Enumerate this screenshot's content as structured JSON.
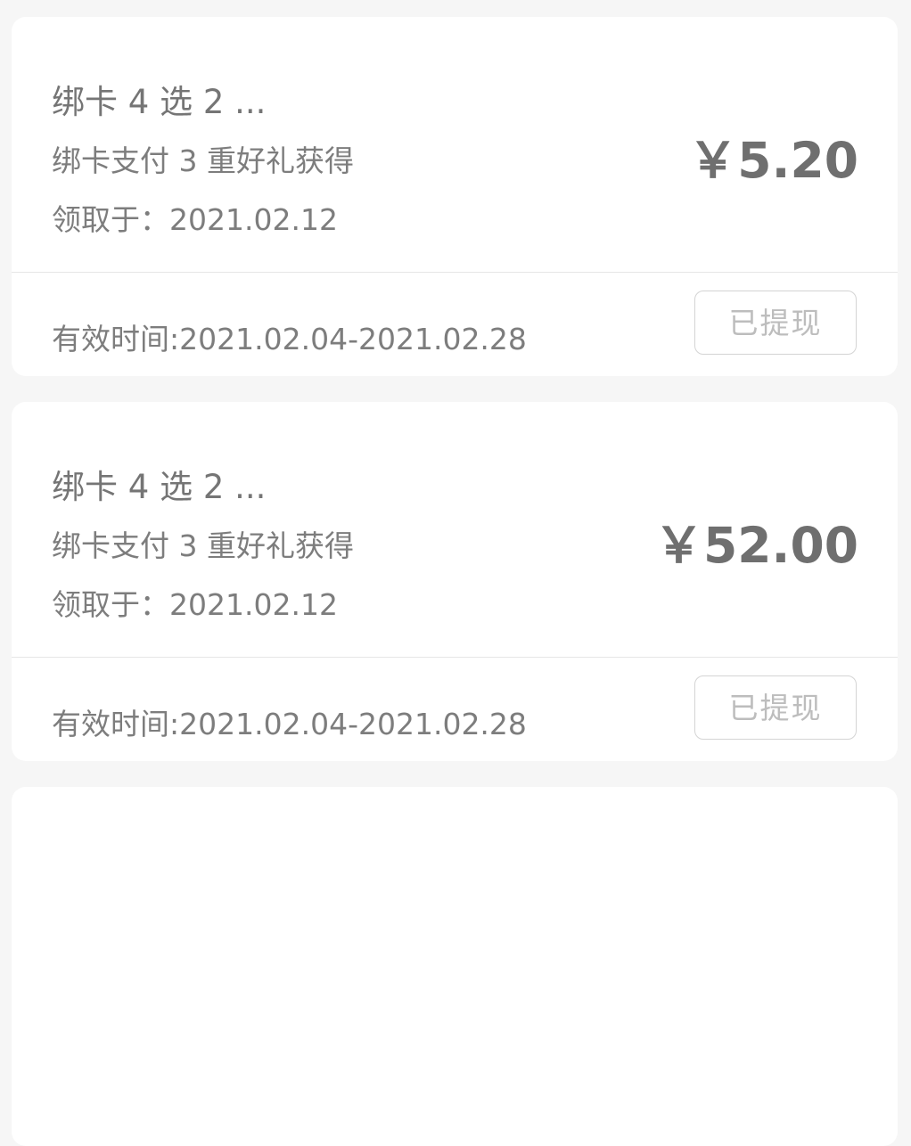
{
  "coupons": [
    {
      "title": "绑卡 4 选 2 ...",
      "subtitle": "绑卡支付 3 重好礼获得",
      "received": "领取于：2021.02.12",
      "amount": "￥5.20",
      "validity": "有效时间:2021.02.04-2021.02.28",
      "status_label": "已提现"
    },
    {
      "title": "绑卡 4 选 2 ...",
      "subtitle": "绑卡支付 3 重好礼获得",
      "received": "领取于：2021.02.12",
      "amount": "￥52.00",
      "validity": "有效时间:2021.02.04-2021.02.28",
      "status_label": "已提现"
    }
  ],
  "colors": {
    "background": "#f6f6f6",
    "card": "#ffffff",
    "text": "#7d7d7d",
    "amount": "#6f6f6f",
    "disabled": "#bdbdbd"
  }
}
